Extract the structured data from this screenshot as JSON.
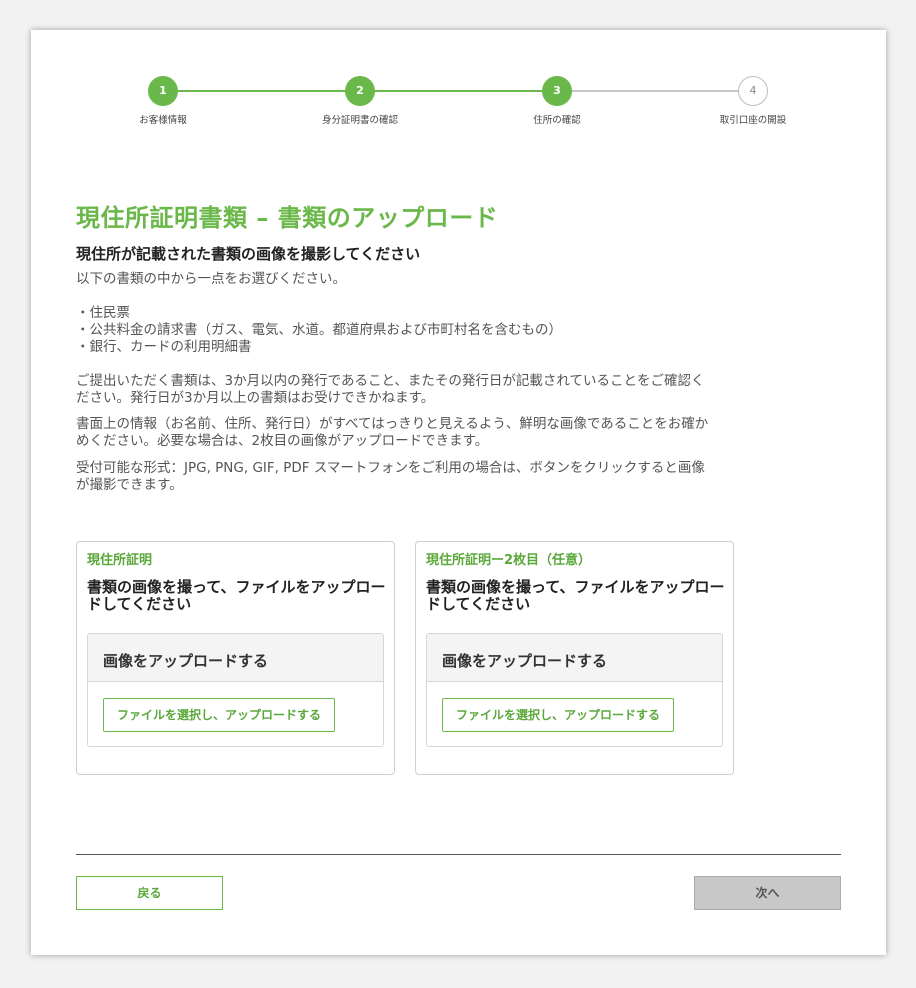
{
  "stepper": {
    "steps": [
      {
        "number": "1",
        "label": "お客様情報"
      },
      {
        "number": "2",
        "label": "身分証明書の確認"
      },
      {
        "number": "3",
        "label": "住所の確認"
      },
      {
        "number": "4",
        "label": "取引口座の開設"
      }
    ],
    "active_color": "#6bb84a",
    "inactive_color": "#c6c6c6"
  },
  "page": {
    "title": "現住所証明書類 – 書類のアップロード",
    "subtitle": "現住所が記載された書類の画像を撮影してください",
    "intro": "以下の書類の中から一点をお選びください。",
    "documents": [
      "・住民票",
      "・公共料金の請求書（ガス、電気、水道。都道府県および市町村名を含むもの）",
      "・銀行、カードの利用明細書"
    ],
    "para1": "ご提出いただく書類は、3か月以内の発行であること、またその発行日が記載されていることをご確認ください。発行日が3か月以上の書類はお受けできかねます。",
    "para2": "書面上の情報（お名前、住所、発行日）がすべてはっきりと見えるよう、鮮明な画像であることをお確かめください。必要な場合は、2枚目の画像がアップロードできます。",
    "para3": "受付可能な形式：JPG, PNG, GIF, PDF スマートフォンをご利用の場合は、ボタンをクリックすると画像が撮影できます。"
  },
  "upload_cards": [
    {
      "title": "現住所証明",
      "heading": "書類の画像を撮って、ファイルをアップロードしてください",
      "box_title": "画像をアップロードする",
      "button_label": "ファイルを選択し、アップロードする"
    },
    {
      "title": "現住所証明ー2枚目（任意）",
      "heading": "書類の画像を撮って、ファイルをアップロードしてください",
      "box_title": "画像をアップロードする",
      "button_label": "ファイルを選択し、アップロードする"
    }
  ],
  "footer": {
    "back_label": "戻る",
    "next_label": "次へ"
  }
}
